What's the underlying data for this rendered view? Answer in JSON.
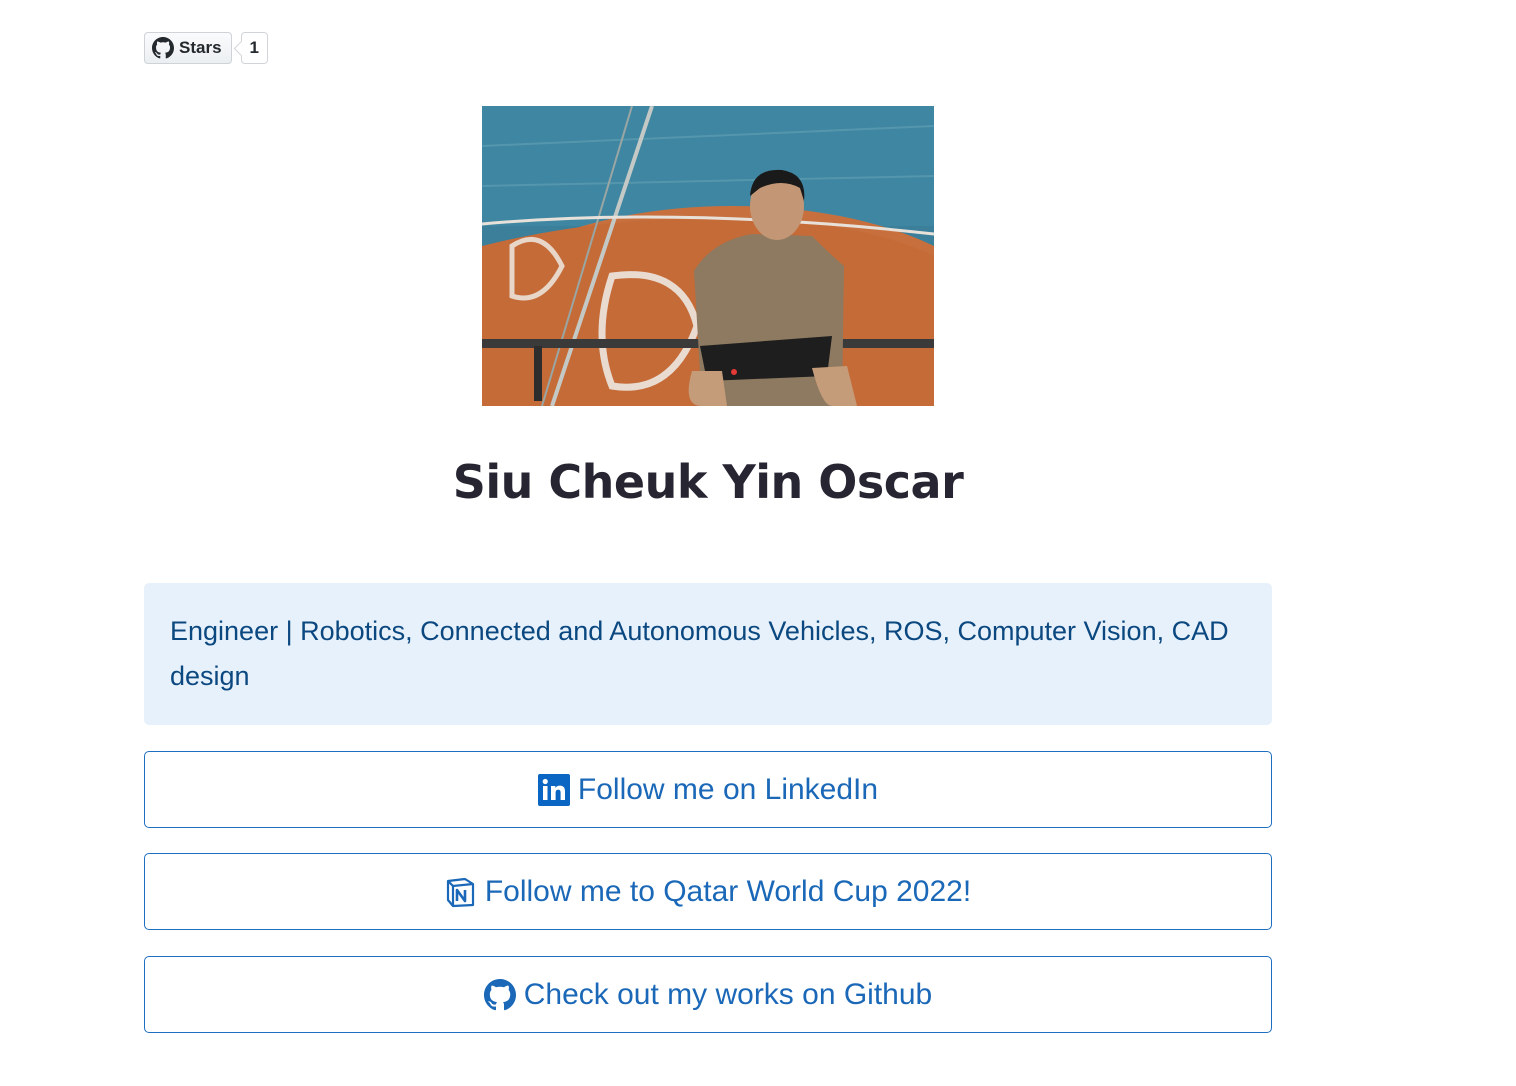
{
  "github_stars": {
    "label": "Stars",
    "count": "1"
  },
  "profile": {
    "name": "Siu Cheuk Yin Oscar",
    "bio": "Engineer | Robotics, Connected and Autonomous Vehicles, ROS, Computer Vision, CAD design"
  },
  "links": [
    {
      "label": "Follow me on LinkedIn",
      "icon": "linkedin-icon"
    },
    {
      "label": "Follow me to Qatar World Cup 2022!",
      "icon": "notion-icon"
    },
    {
      "label": "Check out my works on Github",
      "icon": "github-icon"
    }
  ],
  "colors": {
    "accent": "#1a68b7",
    "bio_background": "#e7f1fb",
    "bio_text": "#0b4880",
    "name_text": "#272532"
  }
}
